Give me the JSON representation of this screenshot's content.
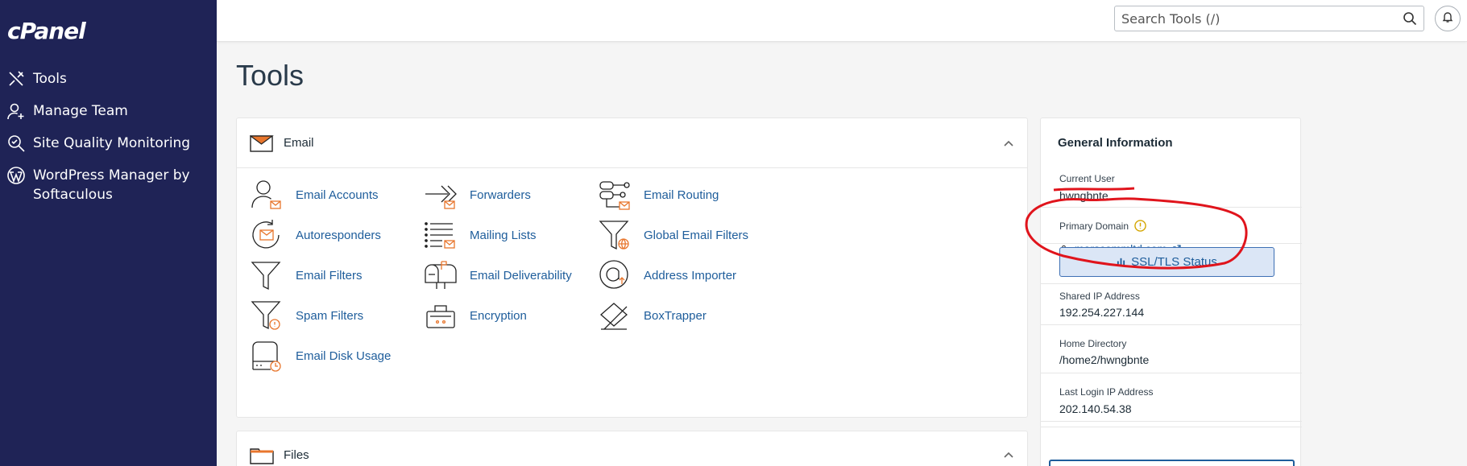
{
  "sidebar": {
    "logo": "cPanel",
    "items": [
      {
        "label": "Tools",
        "icon": "tools-icon"
      },
      {
        "label": "Manage Team",
        "icon": "user-plus-icon"
      },
      {
        "label": "Site Quality Monitoring",
        "icon": "magnifier-check-icon"
      },
      {
        "label": "WordPress Manager by Softaculous",
        "icon": "wordpress-icon"
      }
    ]
  },
  "header": {
    "search_placeholder": "Search Tools (/)"
  },
  "main": {
    "title": "Tools",
    "email": {
      "title": "Email",
      "tools": [
        {
          "label": "Email Accounts",
          "icon": "email-accounts-icon"
        },
        {
          "label": "Forwarders",
          "icon": "forwarders-icon"
        },
        {
          "label": "Email Routing",
          "icon": "email-routing-icon"
        },
        {
          "label": "Autoresponders",
          "icon": "autoresponders-icon"
        },
        {
          "label": "Mailing Lists",
          "icon": "mailing-lists-icon"
        },
        {
          "label": "Global Email Filters",
          "icon": "global-filter-icon"
        },
        {
          "label": "Email Filters",
          "icon": "filter-icon"
        },
        {
          "label": "Email Deliverability",
          "icon": "mailbox-icon"
        },
        {
          "label": "Address Importer",
          "icon": "address-importer-icon"
        },
        {
          "label": "Spam Filters",
          "icon": "spam-filter-icon"
        },
        {
          "label": "Encryption",
          "icon": "encryption-icon"
        },
        {
          "label": "BoxTrapper",
          "icon": "boxtrapper-icon"
        },
        {
          "label": "Email Disk Usage",
          "icon": "disk-usage-icon"
        }
      ]
    },
    "files": {
      "title": "Files"
    }
  },
  "general_info": {
    "title": "General Information",
    "current_user_label": "Current User",
    "current_user_value": "hwngbnte",
    "primary_domain_label": "Primary Domain",
    "primary_domain_value": "marscommltd.com",
    "ssl_button": "SSL/TLS Status",
    "shared_ip_label": "Shared IP Address",
    "shared_ip_value": "192.254.227.144",
    "home_dir_label": "Home Directory",
    "home_dir_value": "/home2/hwngbnte",
    "last_login_label": "Last Login IP Address",
    "last_login_value": "202.140.54.38"
  },
  "colors": {
    "sidebar_bg": "#1f2356",
    "link": "#1e5d9b",
    "accent_orange": "#e8762d",
    "annotation_red": "#e0141c"
  }
}
